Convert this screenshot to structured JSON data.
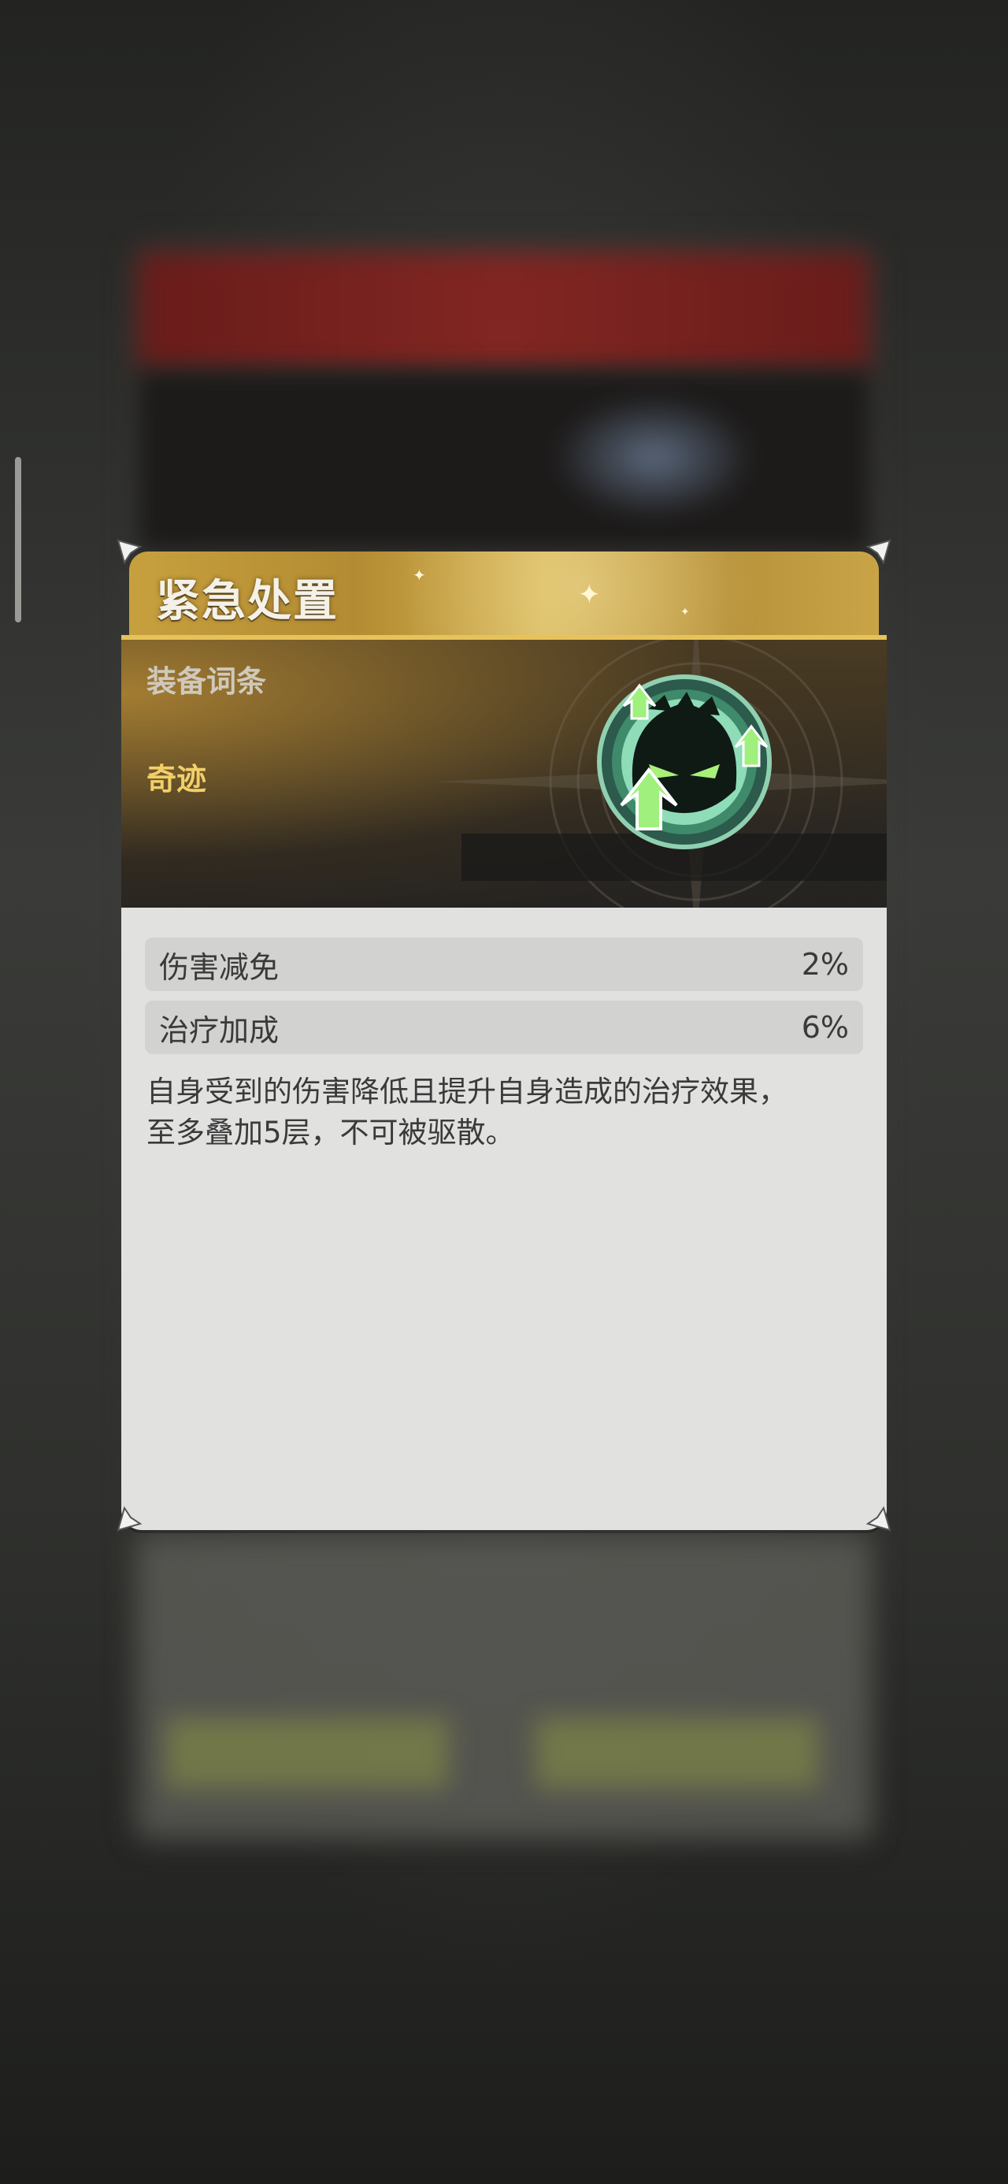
{
  "card": {
    "title": "紧急处置",
    "category_label": "装备词条",
    "rarity": "奇迹",
    "stats": [
      {
        "name": "伤害减免",
        "value": "2%"
      },
      {
        "name": "治疗加成",
        "value": "6%"
      }
    ],
    "description_line1": "自身受到的伤害降低且提升自身造成的治疗效果，",
    "description_line2": "至多叠加5层，不可被驱散。",
    "emblem_icon": "green-face-arrows-icon"
  },
  "colors": {
    "header_gold": "#c9a447",
    "rarity_gold": "#f1cf6a",
    "emblem_green": "#5fd18a",
    "body_bg": "#e1e1e0"
  }
}
